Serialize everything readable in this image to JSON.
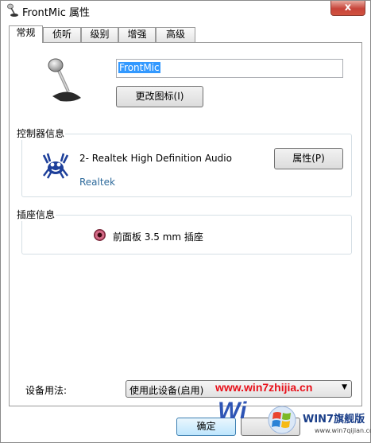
{
  "window": {
    "title": "FrontMic 属性",
    "close_glyph": "x"
  },
  "tabs": [
    {
      "label": "常规"
    },
    {
      "label": "侦听"
    },
    {
      "label": "级别"
    },
    {
      "label": "增强"
    },
    {
      "label": "高级"
    }
  ],
  "general": {
    "device_name_value": "FrontMic",
    "change_icon_label": "更改图标(I)"
  },
  "controller": {
    "group_label": "控制器信息",
    "device_name": "2- Realtek High Definition Audio",
    "vendor": "Realtek",
    "properties_label": "属性(P)"
  },
  "jack": {
    "group_label": "插座信息",
    "description": "前面板 3.5 mm 插座",
    "color": "#d46a86"
  },
  "usage": {
    "label": "设备用法:",
    "selected": "使用此设备(启用)"
  },
  "footer": {
    "ok_label": "确定"
  },
  "watermark": {
    "url": "www.win7zhijia.cn",
    "big_text": "Wi",
    "brand": "WIN7旗舰版",
    "site": "www.win7qijian.com"
  },
  "icons": {
    "title": "microphone-icon",
    "device": "microphone-icon",
    "controller": "realtek-crab-icon",
    "jack": "audio-jack-icon",
    "dropdown": "chevron-down-icon"
  }
}
